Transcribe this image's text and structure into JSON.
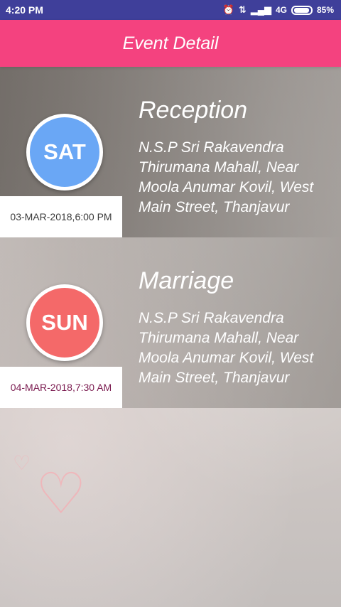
{
  "status_bar": {
    "time": "4:20 PM",
    "network": "4G",
    "battery": "85%",
    "icons": [
      "alarm-icon",
      "data-transfer-icon",
      "signal-icon",
      "battery-icon"
    ]
  },
  "app_bar": {
    "title": "Event Detail"
  },
  "colors": {
    "status_bar": "#3f3f9a",
    "app_bar": "#f4427f",
    "sat_circle": "#6aa7f5",
    "sun_circle": "#f46969"
  },
  "events": [
    {
      "day": "SAT",
      "date": "03-MAR-2018,6:00 PM",
      "title": "Reception",
      "address": "N.S.P Sri Rakavendra Thirumana Mahall, Near Moola Anumar Kovil, West Main Street, Thanjavur"
    },
    {
      "day": "SUN",
      "date": "04-MAR-2018,7:30 AM",
      "title": "Marriage",
      "address": "N.S.P Sri Rakavendra Thirumana Mahall, Near Moola Anumar Kovil, West Main Street, Thanjavur"
    }
  ]
}
